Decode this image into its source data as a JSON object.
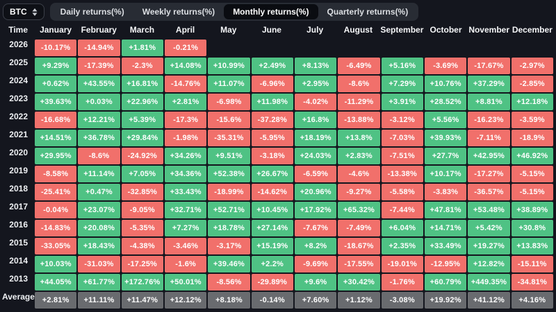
{
  "selector": {
    "label": "BTC"
  },
  "tabs": [
    {
      "label": "Daily returns(%)",
      "active": false
    },
    {
      "label": "Weekly returns(%)",
      "active": false
    },
    {
      "label": "Monthly returns(%)",
      "active": true
    },
    {
      "label": "Quarterly returns(%)",
      "active": false
    }
  ],
  "table": {
    "time_header": "Time",
    "months": [
      "January",
      "February",
      "March",
      "April",
      "May",
      "June",
      "July",
      "August",
      "September",
      "October",
      "November",
      "December"
    ],
    "rows": [
      {
        "year": "2026",
        "cells": [
          "-10.17%",
          "-14.94%",
          "+1.81%",
          "-0.21%",
          "",
          "",
          "",
          "",
          "",
          "",
          "",
          ""
        ]
      },
      {
        "year": "2025",
        "cells": [
          "+9.29%",
          "-17.39%",
          "-2.3%",
          "+14.08%",
          "+10.99%",
          "+2.49%",
          "+8.13%",
          "-6.49%",
          "+5.16%",
          "-3.69%",
          "-17.67%",
          "-2.97%"
        ]
      },
      {
        "year": "2024",
        "cells": [
          "+0.62%",
          "+43.55%",
          "+16.81%",
          "-14.76%",
          "+11.07%",
          "-6.96%",
          "+2.95%",
          "-8.6%",
          "+7.29%",
          "+10.76%",
          "+37.29%",
          "-2.85%"
        ]
      },
      {
        "year": "2023",
        "cells": [
          "+39.63%",
          "+0.03%",
          "+22.96%",
          "+2.81%",
          "-6.98%",
          "+11.98%",
          "-4.02%",
          "-11.29%",
          "+3.91%",
          "+28.52%",
          "+8.81%",
          "+12.18%"
        ]
      },
      {
        "year": "2022",
        "cells": [
          "-16.68%",
          "+12.21%",
          "+5.39%",
          "-17.3%",
          "-15.6%",
          "-37.28%",
          "+16.8%",
          "-13.88%",
          "-3.12%",
          "+5.56%",
          "-16.23%",
          "-3.59%"
        ]
      },
      {
        "year": "2021",
        "cells": [
          "+14.51%",
          "+36.78%",
          "+29.84%",
          "-1.98%",
          "-35.31%",
          "-5.95%",
          "+18.19%",
          "+13.8%",
          "-7.03%",
          "+39.93%",
          "-7.11%",
          "-18.9%"
        ]
      },
      {
        "year": "2020",
        "cells": [
          "+29.95%",
          "-8.6%",
          "-24.92%",
          "+34.26%",
          "+9.51%",
          "-3.18%",
          "+24.03%",
          "+2.83%",
          "-7.51%",
          "+27.7%",
          "+42.95%",
          "+46.92%"
        ]
      },
      {
        "year": "2019",
        "cells": [
          "-8.58%",
          "+11.14%",
          "+7.05%",
          "+34.36%",
          "+52.38%",
          "+26.67%",
          "-6.59%",
          "-4.6%",
          "-13.38%",
          "+10.17%",
          "-17.27%",
          "-5.15%"
        ]
      },
      {
        "year": "2018",
        "cells": [
          "-25.41%",
          "+0.47%",
          "-32.85%",
          "+33.43%",
          "-18.99%",
          "-14.62%",
          "+20.96%",
          "-9.27%",
          "-5.58%",
          "-3.83%",
          "-36.57%",
          "-5.15%"
        ]
      },
      {
        "year": "2017",
        "cells": [
          "-0.04%",
          "+23.07%",
          "-9.05%",
          "+32.71%",
          "+52.71%",
          "+10.45%",
          "+17.92%",
          "+65.32%",
          "-7.44%",
          "+47.81%",
          "+53.48%",
          "+38.89%"
        ]
      },
      {
        "year": "2016",
        "cells": [
          "-14.83%",
          "+20.08%",
          "-5.35%",
          "+7.27%",
          "+18.78%",
          "+27.14%",
          "-7.67%",
          "-7.49%",
          "+6.04%",
          "+14.71%",
          "+5.42%",
          "+30.8%"
        ]
      },
      {
        "year": "2015",
        "cells": [
          "-33.05%",
          "+18.43%",
          "-4.38%",
          "-3.46%",
          "-3.17%",
          "+15.19%",
          "+8.2%",
          "-18.67%",
          "+2.35%",
          "+33.49%",
          "+19.27%",
          "+13.83%"
        ]
      },
      {
        "year": "2014",
        "cells": [
          "+10.03%",
          "-31.03%",
          "-17.25%",
          "-1.6%",
          "+39.46%",
          "+2.2%",
          "-9.69%",
          "-17.55%",
          "-19.01%",
          "-12.95%",
          "+12.82%",
          "-15.11%"
        ]
      },
      {
        "year": "2013",
        "cells": [
          "+44.05%",
          "+61.77%",
          "+172.76%",
          "+50.01%",
          "-8.56%",
          "-29.89%",
          "+9.6%",
          "+30.42%",
          "-1.76%",
          "+60.79%",
          "+449.35%",
          "-34.81%"
        ]
      },
      {
        "year": "Average",
        "cells": [
          "+2.81%",
          "+11.11%",
          "+11.47%",
          "+12.12%",
          "+8.18%",
          "-0.14%",
          "+7.60%",
          "+1.12%",
          "-3.08%",
          "+19.92%",
          "+41.12%",
          "+4.16%"
        ]
      }
    ]
  },
  "colors": {
    "positive": "#4fc284",
    "negative": "#f1706b",
    "average": "#696b6f",
    "background": "#14161e"
  }
}
